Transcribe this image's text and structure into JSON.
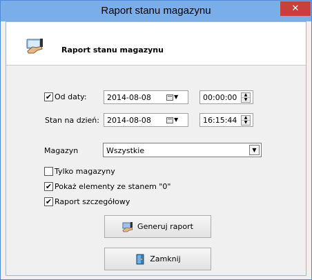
{
  "window": {
    "title": "Raport stanu magazynu",
    "close_glyph": "✕"
  },
  "header": {
    "title": "Raport stanu magazynu",
    "icon": "report-hand-icon"
  },
  "form": {
    "od_daty": {
      "label": "Od daty:",
      "checked": true,
      "check_glyph": "✔",
      "date": "2014-08-08",
      "time": "00:00:00"
    },
    "stan_na_dzien": {
      "label": "Stan na dzień:",
      "date": "2014-08-08",
      "time": "16:15:44"
    },
    "magazyn": {
      "label": "Magazyn",
      "selected": "Wszystkie"
    },
    "options": [
      {
        "label": "Tylko magazyny",
        "checked": false,
        "glyph": ""
      },
      {
        "label": "Pokaż elementy ze stanem \"0\"",
        "checked": true,
        "glyph": "✔"
      },
      {
        "label": "Raport szczegółowy",
        "checked": true,
        "glyph": "✔"
      }
    ]
  },
  "buttons": {
    "generate": "Generuj raport",
    "close": "Zamknij"
  },
  "colors": {
    "titlebar": "#79aee8",
    "close_button": "#c9403a",
    "frame": "#4a8ad8"
  }
}
